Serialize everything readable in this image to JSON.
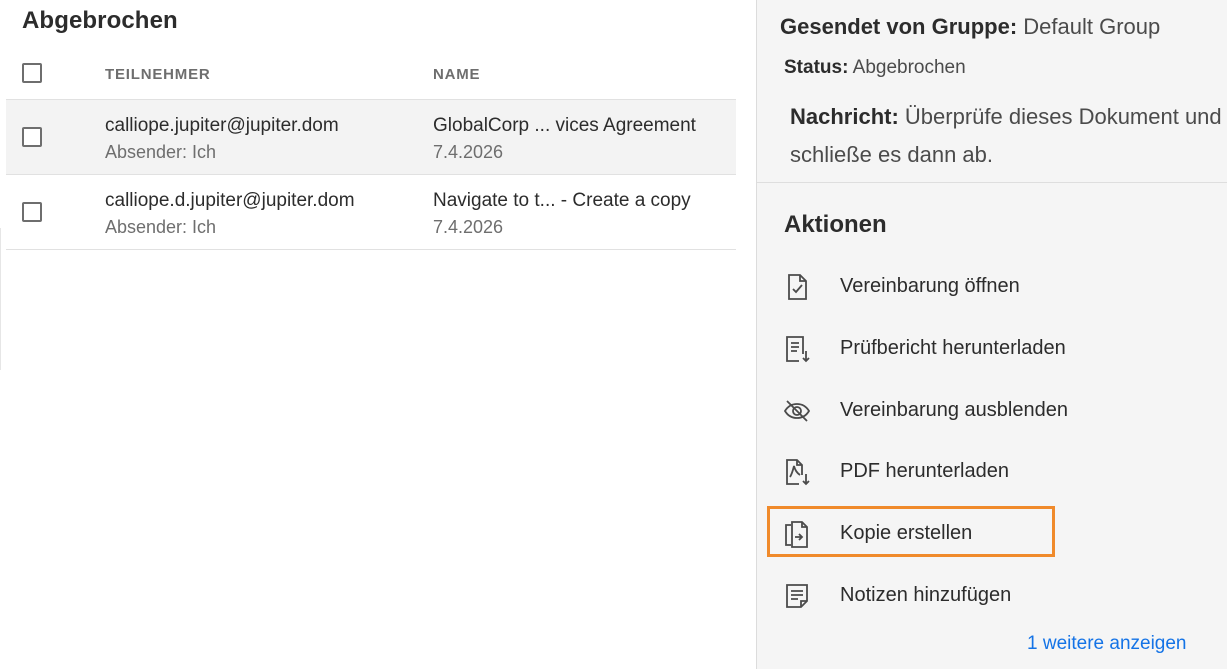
{
  "list": {
    "title": "Abgebrochen",
    "columns": {
      "participant": "TEILNEHMER",
      "name": "NAME"
    },
    "rows": [
      {
        "participant": "calliope.jupiter@jupiter.dom",
        "sender": "Absender: Ich",
        "name": "GlobalCorp ... vices Agreement",
        "date": "7.4.2026"
      },
      {
        "participant": "calliope.d.jupiter@jupiter.dom",
        "sender": "Absender: Ich",
        "name": "Navigate to t... - Create a copy",
        "date": "7.4.2026"
      }
    ]
  },
  "details": {
    "group_label": "Gesendet von Gruppe:",
    "group_value": "Default Group",
    "status_label": "Status:",
    "status_value": "Abgebrochen",
    "message_label": "Nachricht:",
    "message_value": "Überprüfe dieses Dokument und schließe es dann ab."
  },
  "actions": {
    "title": "Aktionen",
    "items": [
      {
        "label": "Vereinbarung öffnen",
        "icon": "document-check-icon"
      },
      {
        "label": "Prüfbericht herunterladen",
        "icon": "report-download-icon"
      },
      {
        "label": "Vereinbarung ausblenden",
        "icon": "eye-hidden-icon"
      },
      {
        "label": "PDF herunterladen",
        "icon": "pdf-download-icon"
      },
      {
        "label": "Kopie erstellen",
        "icon": "copy-icon"
      },
      {
        "label": "Notizen hinzufügen",
        "icon": "notes-icon"
      }
    ],
    "more_link": "1 weitere anzeigen"
  },
  "colors": {
    "highlight": "#f08a2b",
    "link": "#1473e6"
  }
}
